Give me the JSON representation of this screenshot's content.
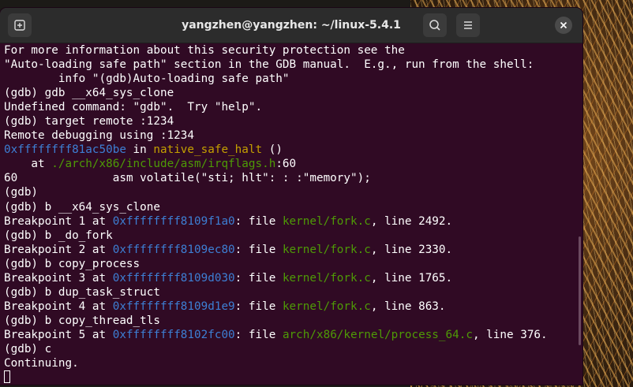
{
  "window": {
    "title": "yangzhen@yangzhen: ~/linux-5.4.1"
  },
  "icons": {
    "new_tab": "new-tab-icon",
    "search": "search-icon",
    "menu": "hamburger-menu-icon",
    "close": "close-icon"
  },
  "colors": {
    "terminal_bg": "#300a24",
    "text": "#ffffff",
    "address": "#3d7fd4",
    "function": "#c4a000",
    "path": "#4e9a06"
  },
  "terminal": {
    "lines": [
      [
        {
          "t": "For more information about this security protection see the"
        }
      ],
      [
        {
          "t": "\"Auto-loading safe path\" section in the GDB manual.  E.g., run from the shell:"
        }
      ],
      [
        {
          "t": "        info \"(gdb)Auto-loading safe path\""
        }
      ],
      [
        {
          "t": "(gdb) gdb __x64_sys_clone"
        }
      ],
      [
        {
          "t": "Undefined command: \"gdb\".  Try \"help\"."
        }
      ],
      [
        {
          "t": "(gdb) target remote :1234"
        }
      ],
      [
        {
          "t": "Remote debugging using :1234"
        }
      ],
      [
        {
          "t": "0xffffffff81ac50be",
          "c": "addr"
        },
        {
          "t": " in "
        },
        {
          "t": "native_safe_halt",
          "c": "func"
        },
        {
          "t": " ()"
        }
      ],
      [
        {
          "t": "    at "
        },
        {
          "t": "./arch/x86/include/asm/irqflags.h",
          "c": "path"
        },
        {
          "t": ":60"
        }
      ],
      [
        {
          "t": "60\t\tasm volatile(\"sti; hlt\": : :\"memory\");"
        }
      ],
      [
        {
          "t": "(gdb)"
        }
      ],
      [
        {
          "t": "(gdb) b __x64_sys_clone"
        }
      ],
      [
        {
          "t": "Breakpoint 1 at "
        },
        {
          "t": "0xffffffff8109f1a0",
          "c": "addr"
        },
        {
          "t": ": file "
        },
        {
          "t": "kernel/fork.c",
          "c": "path"
        },
        {
          "t": ", line 2492."
        }
      ],
      [
        {
          "t": "(gdb) b _do_fork"
        }
      ],
      [
        {
          "t": "Breakpoint 2 at "
        },
        {
          "t": "0xffffffff8109ec80",
          "c": "addr"
        },
        {
          "t": ": file "
        },
        {
          "t": "kernel/fork.c",
          "c": "path"
        },
        {
          "t": ", line 2330."
        }
      ],
      [
        {
          "t": "(gdb) b copy_process"
        }
      ],
      [
        {
          "t": "Breakpoint 3 at "
        },
        {
          "t": "0xffffffff8109d030",
          "c": "addr"
        },
        {
          "t": ": file "
        },
        {
          "t": "kernel/fork.c",
          "c": "path"
        },
        {
          "t": ", line 1765."
        }
      ],
      [
        {
          "t": "(gdb) b dup_task_struct"
        }
      ],
      [
        {
          "t": "Breakpoint 4 at "
        },
        {
          "t": "0xffffffff8109d1e9",
          "c": "addr"
        },
        {
          "t": ": file "
        },
        {
          "t": "kernel/fork.c",
          "c": "path"
        },
        {
          "t": ", line 863."
        }
      ],
      [
        {
          "t": "(gdb) b copy_thread_tls"
        }
      ],
      [
        {
          "t": "Breakpoint 5 at "
        },
        {
          "t": "0xffffffff8102fc00",
          "c": "addr"
        },
        {
          "t": ": file "
        },
        {
          "t": "arch/x86/kernel/process_64.c",
          "c": "path"
        },
        {
          "t": ", line 376."
        }
      ],
      [
        {
          "t": "(gdb) c"
        }
      ],
      [
        {
          "t": "Continuing."
        }
      ]
    ]
  }
}
